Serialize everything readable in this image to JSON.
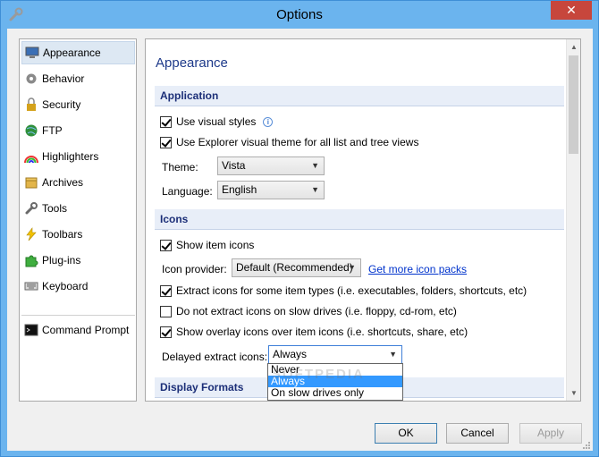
{
  "window": {
    "title": "Options",
    "close_glyph": "✕"
  },
  "nav": {
    "items": [
      {
        "label": "Appearance",
        "icon": "monitor-icon",
        "selected": true
      },
      {
        "label": "Behavior",
        "icon": "gear-icon"
      },
      {
        "label": "Security",
        "icon": "lock-icon"
      },
      {
        "label": "FTP",
        "icon": "globe-icon"
      },
      {
        "label": "Highlighters",
        "icon": "rainbow-icon"
      },
      {
        "label": "Archives",
        "icon": "box-icon"
      },
      {
        "label": "Tools",
        "icon": "wrench-icon"
      },
      {
        "label": "Toolbars",
        "icon": "lightning-icon"
      },
      {
        "label": "Plug-ins",
        "icon": "puzzle-icon"
      },
      {
        "label": "Keyboard",
        "icon": "keyboard-icon"
      },
      {
        "label": "Command Prompt",
        "icon": "console-icon"
      }
    ]
  },
  "panel": {
    "title": "Appearance",
    "application": {
      "heading": "Application",
      "use_visual_styles": "Use visual styles",
      "use_explorer_theme": "Use Explorer visual theme for all list and tree views",
      "theme_label": "Theme:",
      "theme_value": "Vista",
      "language_label": "Language:",
      "language_value": "English"
    },
    "icons": {
      "heading": "Icons",
      "show_item_icons": "Show item icons",
      "icon_provider_label": "Icon provider:",
      "icon_provider_value": "Default (Recommended)",
      "get_more_link": "Get more icon packs",
      "extract_icons": "Extract icons for some item types (i.e. executables, folders, shortcuts, etc)",
      "no_extract_slow": "Do not extract icons on slow drives (i.e. floppy, cd-rom, etc)",
      "show_overlay": "Show overlay icons over item icons (i.e. shortcuts, share, etc)",
      "delayed_label": "Delayed extract icons:",
      "delayed_value": "Always",
      "delayed_options": [
        "Never",
        "Always",
        "On slow drives only"
      ]
    },
    "display_formats": {
      "heading": "Display Formats"
    }
  },
  "watermark": "SOFTPEDIA",
  "buttons": {
    "ok": "OK",
    "cancel": "Cancel",
    "apply": "Apply"
  },
  "colors": {
    "title_bar": "#6bb4ee",
    "close": "#c7463c",
    "section_head": "#1c2f78",
    "link": "#0033cc",
    "selection": "#3399ff"
  }
}
